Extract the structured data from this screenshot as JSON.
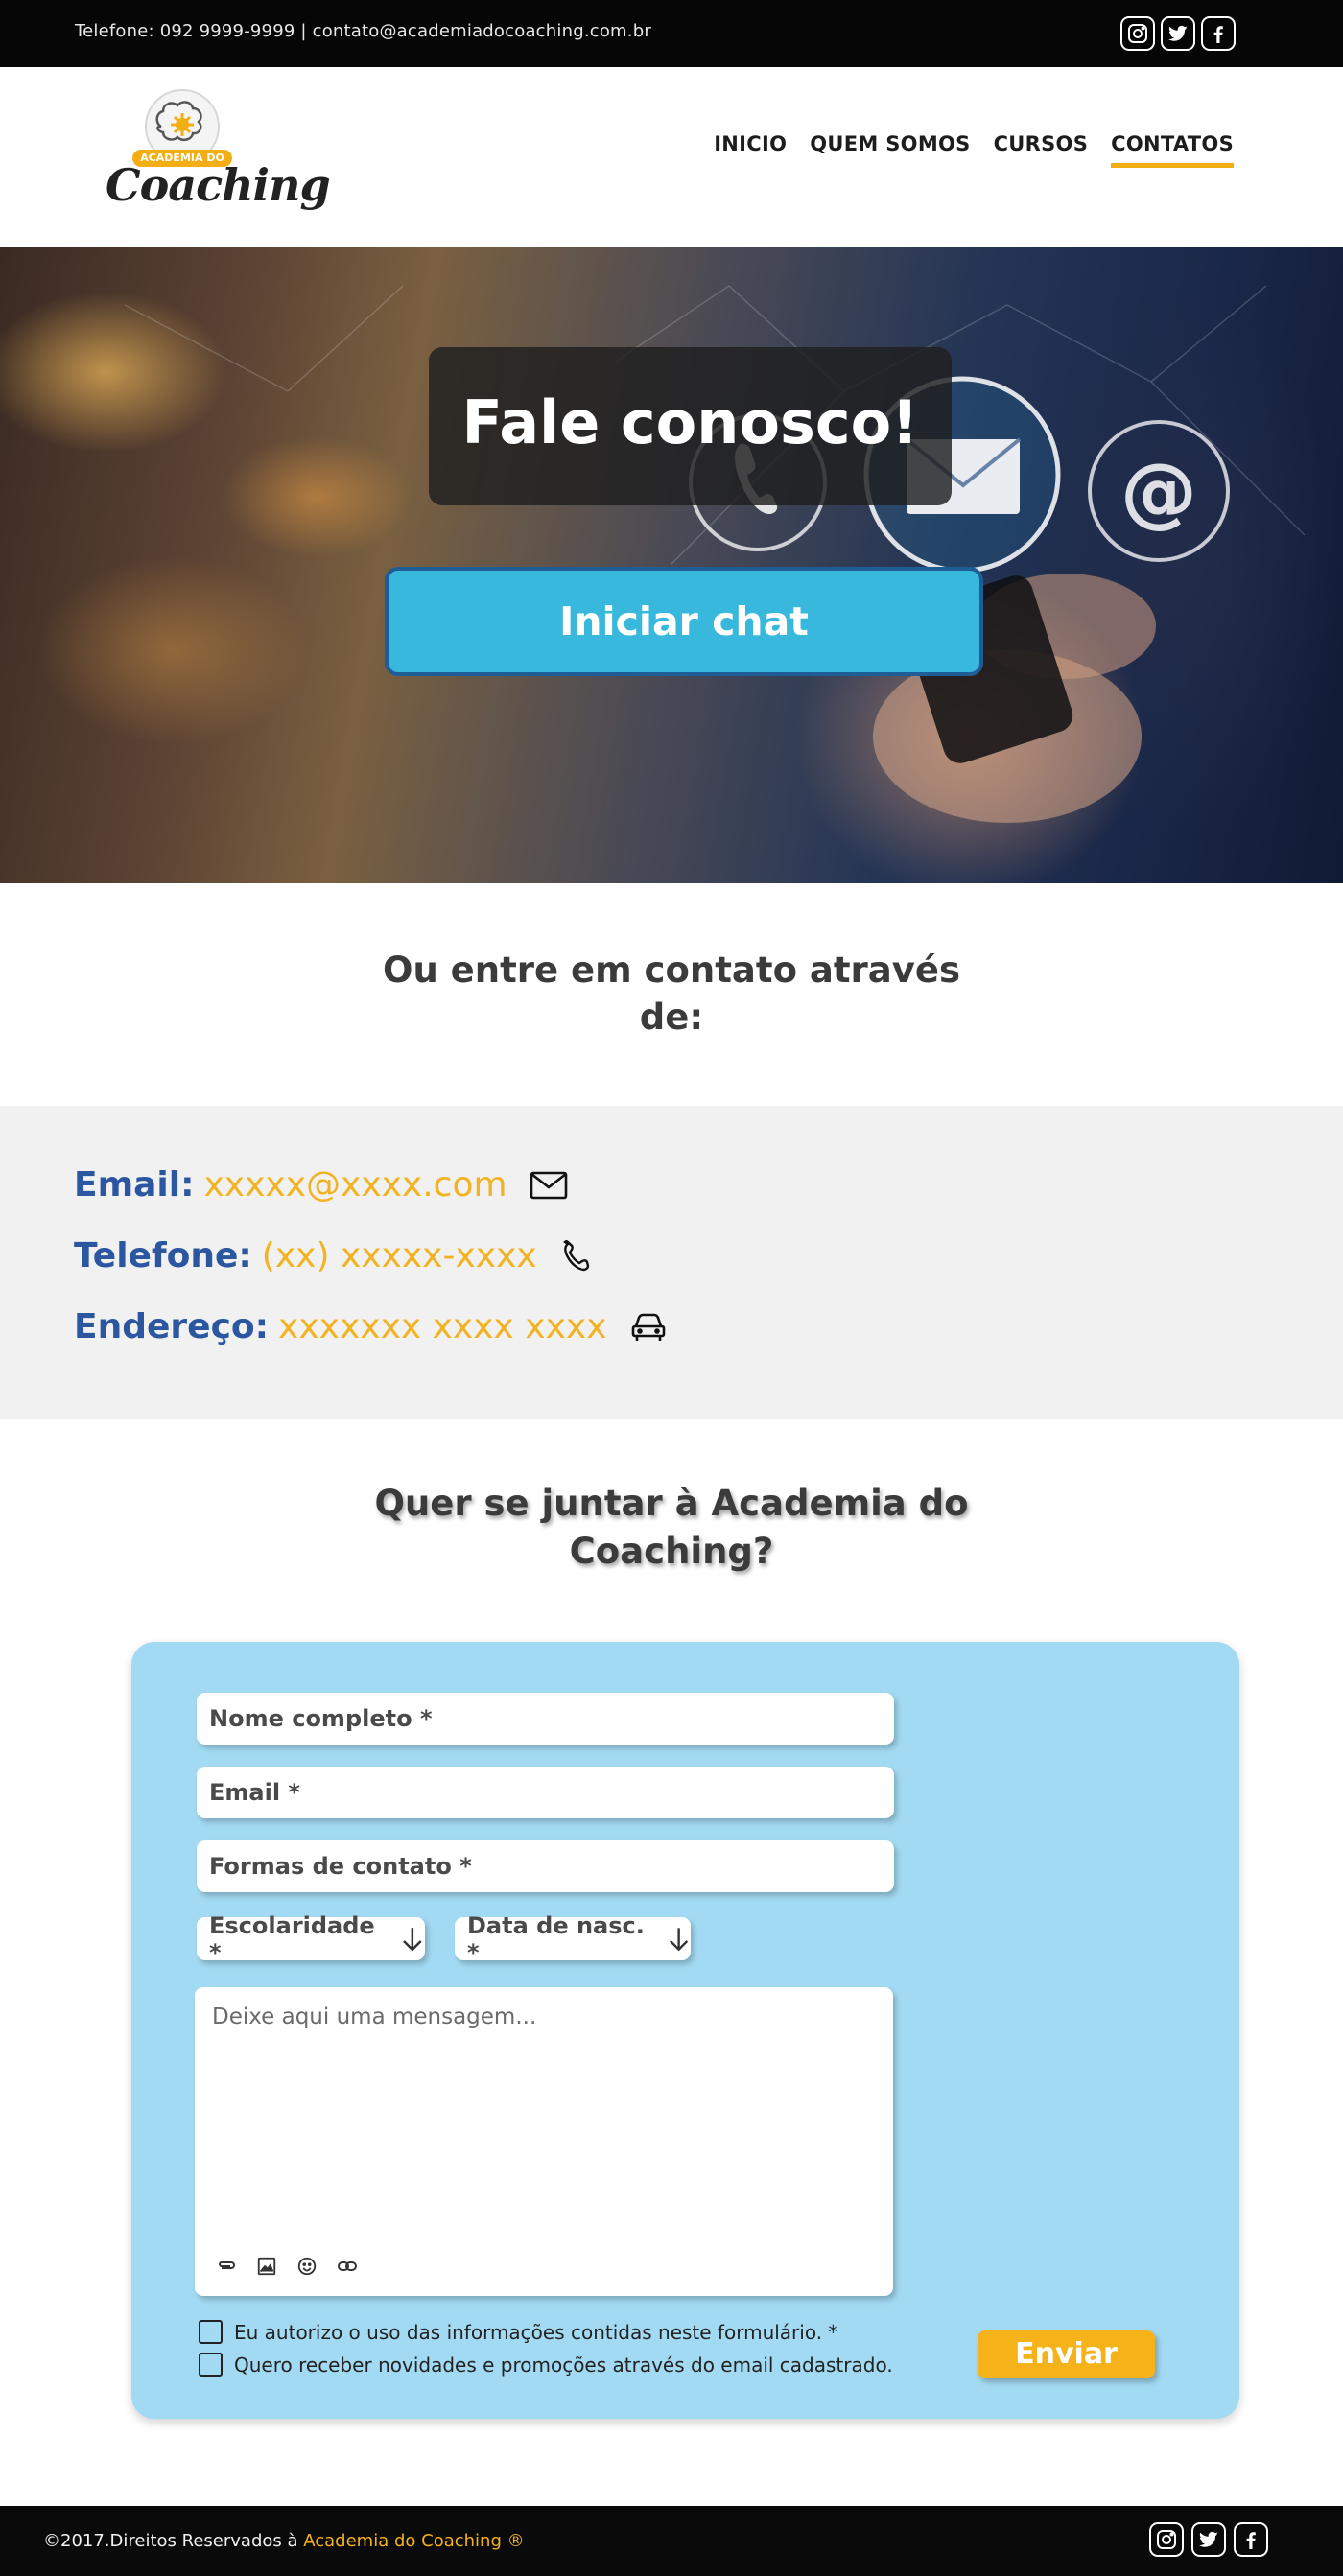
{
  "topbar": {
    "contact_text": "Telefone: 092 9999-9999  |  contato@academiadocoaching.com.br",
    "social": [
      "instagram-icon",
      "twitter-icon",
      "facebook-icon"
    ]
  },
  "header": {
    "logo_word": "Coaching",
    "logo_badge": "ACADEMIA DO",
    "nav": [
      {
        "label": "INICIO",
        "active": false
      },
      {
        "label": "QUEM SOMOS",
        "active": false
      },
      {
        "label": "CURSOS",
        "active": false
      },
      {
        "label": "CONTATOS",
        "active": true
      }
    ]
  },
  "hero": {
    "title": "Fale conosco!",
    "chat_button": "Iniciar chat"
  },
  "contact_section": {
    "heading": "Ou entre em contato através de:",
    "items": [
      {
        "label": "Email:",
        "value": "xxxxx@xxxx.com",
        "icon": "mail-icon"
      },
      {
        "label": "Telefone:",
        "value": "(xx) xxxxx-xxxx",
        "icon": "phone-icon"
      },
      {
        "label": "Endereço:",
        "value": "xxxxxxx xxxx xxxx",
        "icon": "car-icon"
      }
    ]
  },
  "join": {
    "heading": "Quer se juntar à Academia do Coaching?",
    "form": {
      "name": "Nome completo *",
      "email": "Email *",
      "contact_forms": "Formas de contato *",
      "education": "Escolaridade *",
      "birth_date": "Data de nasc. *",
      "message_placeholder": "Deixe aqui uma mensagem...",
      "consent": "Eu autorizo o uso das informações contidas neste formulário. *",
      "newsletter": "Quero receber novidades e promoções através do email cadastrado.",
      "submit": "Enviar"
    }
  },
  "footer": {
    "copyright": "©2017.Direitos Reservados à ",
    "brand": "Academia do Coaching ®"
  },
  "colors": {
    "accent": "#f2ae12",
    "label_blue": "#2b56a0",
    "chat_button": "#38b8dc",
    "form_card": "#a3daf3"
  }
}
